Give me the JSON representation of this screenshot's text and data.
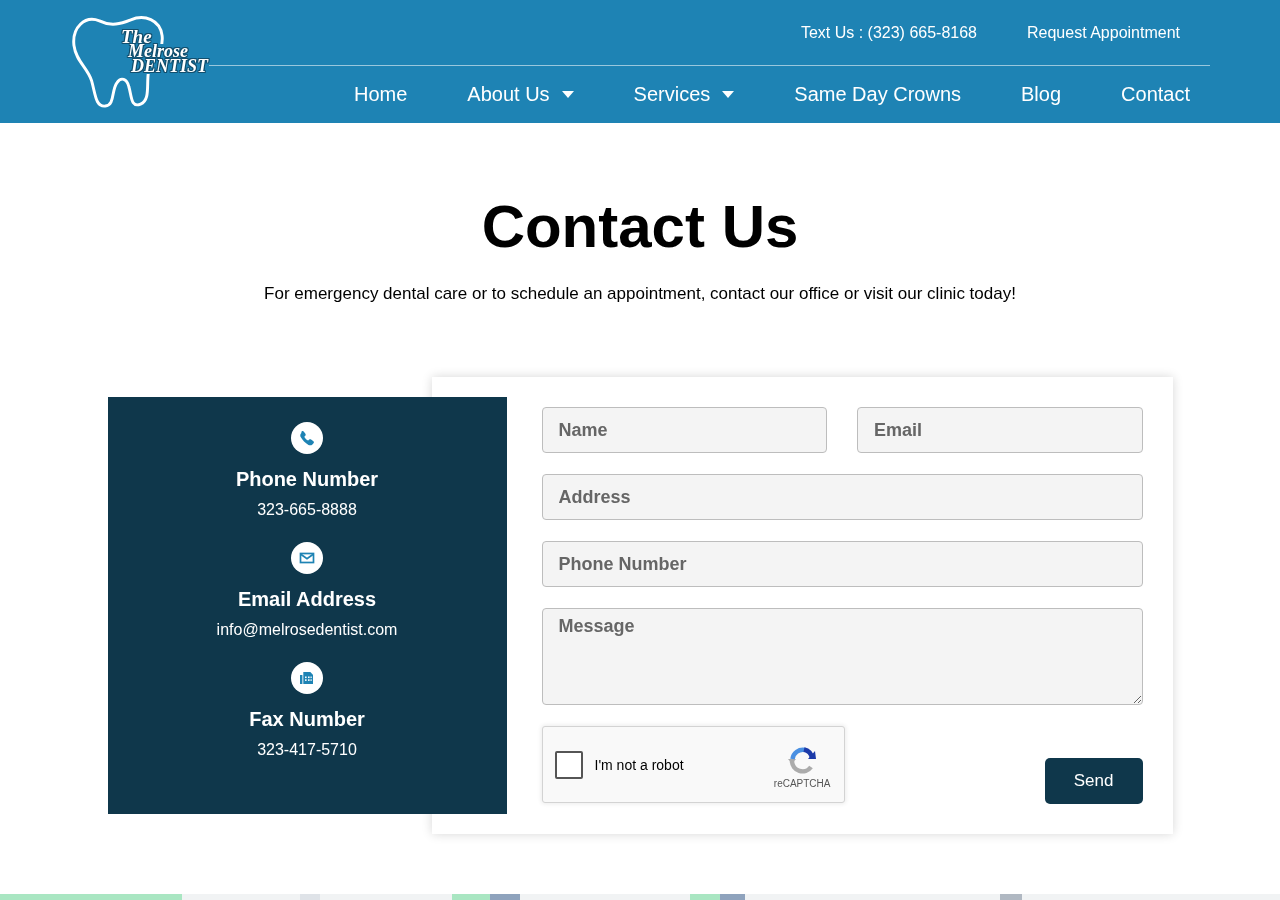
{
  "header": {
    "logo": {
      "lines": [
        "The",
        "Melrose",
        "DENTIST"
      ]
    },
    "top_links": [
      "Text Us : (323) 665-8168",
      "Request Appointment"
    ],
    "nav": [
      {
        "label": "Home",
        "dropdown": false
      },
      {
        "label": "About Us",
        "dropdown": true
      },
      {
        "label": "Services",
        "dropdown": true
      },
      {
        "label": "Same Day Crowns",
        "dropdown": false
      },
      {
        "label": "Blog",
        "dropdown": false
      },
      {
        "label": "Contact",
        "dropdown": false
      }
    ]
  },
  "hero": {
    "title": "Contact Us",
    "subtitle": "For emergency dental care or to schedule an appointment, contact our office or visit our clinic today!"
  },
  "contact_info": [
    {
      "kind": "phone",
      "heading": "Phone Number",
      "value": "323-665-8888"
    },
    {
      "kind": "email",
      "heading": "Email Address",
      "value": "info@melrosedentist.com"
    },
    {
      "kind": "fax",
      "heading": "Fax Number",
      "value": "323-417-5710"
    }
  ],
  "form": {
    "fields": [
      {
        "kind": "short",
        "placeholder": "Name"
      },
      {
        "kind": "short",
        "placeholder": "Email"
      },
      {
        "kind": "long",
        "placeholder": "Address"
      },
      {
        "kind": "long",
        "placeholder": "Phone Number"
      },
      {
        "kind": "multiline",
        "placeholder": "Message"
      }
    ],
    "captcha": {
      "checked": false,
      "label": "I'm not a robot",
      "brand": "reCAPTCHA"
    },
    "submit": "Send"
  }
}
